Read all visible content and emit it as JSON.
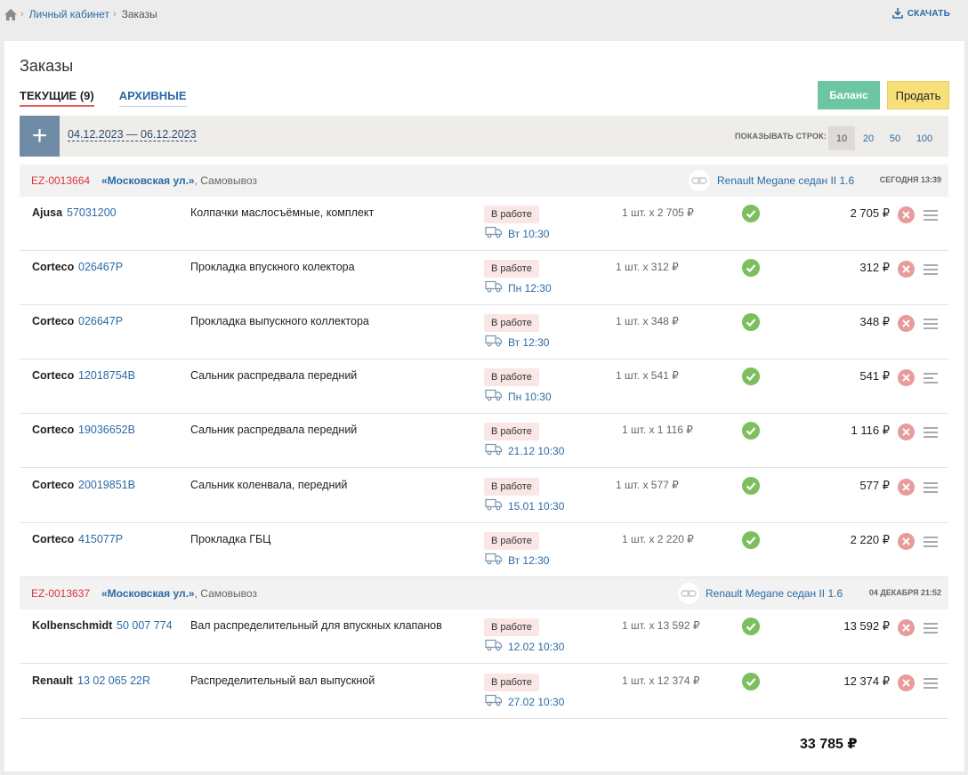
{
  "breadcrumb": {
    "home_icon": "home-icon",
    "cabinet": "Личный кабинет",
    "current": "Заказы"
  },
  "download": {
    "label": "СКАЧАТЬ",
    "icon": "download-icon"
  },
  "page": {
    "title": "Заказы"
  },
  "tabs": [
    {
      "label": "ТЕКУЩИЕ (9)",
      "active": true
    },
    {
      "label": "АРХИВНЫЕ",
      "active": false
    }
  ],
  "actions": {
    "balance": "Баланс",
    "sell": "Продать"
  },
  "filter": {
    "add_label": "+",
    "date_range": "04.12.2023 — 06.12.2023",
    "rows_label": "ПОКАЗЫВАТЬ СТРОК:",
    "rows_options": [
      "10",
      "20",
      "50",
      "100"
    ],
    "rows_selected": "10"
  },
  "orders": [
    {
      "id": "EZ-0013664",
      "address": "«Московская ул.»",
      "delivery": ", Самовывоз",
      "car": "Renault Megane седан II 1.6",
      "date": "СЕГОДНЯ 13:39",
      "items": [
        {
          "brand": "Ajusa",
          "number": "57031200",
          "name": "Колпачки маслосъёмные, комплект",
          "status": "В работе",
          "eta": "Вт 10:30",
          "qty": "1 шт. x 2 705 ₽",
          "price": "2 705 ₽"
        },
        {
          "brand": "Corteco",
          "number": "026467P",
          "name": "Прокладка впускного колектора",
          "status": "В работе",
          "eta": "Пн 12:30",
          "qty": "1 шт. x 312 ₽",
          "price": "312 ₽"
        },
        {
          "brand": "Corteco",
          "number": "026647P",
          "name": "Прокладка выпускного коллектора",
          "status": "В работе",
          "eta": "Вт 12:30",
          "qty": "1 шт. x 348 ₽",
          "price": "348 ₽"
        },
        {
          "brand": "Corteco",
          "number": "12018754B",
          "name": "Сальник распредвала передний",
          "status": "В работе",
          "eta": "Пн 10:30",
          "qty": "1 шт. x 541 ₽",
          "price": "541 ₽"
        },
        {
          "brand": "Corteco",
          "number": "19036652B",
          "name": "Сальник распредвала передний",
          "status": "В работе",
          "eta": "21.12 10:30",
          "qty": "1 шт. x 1 116 ₽",
          "price": "1 116 ₽"
        },
        {
          "brand": "Corteco",
          "number": "20019851B",
          "name": "Сальник коленвала, передний",
          "status": "В работе",
          "eta": "15.01 10:30",
          "qty": "1 шт. x 577 ₽",
          "price": "577 ₽"
        },
        {
          "brand": "Corteco",
          "number": "415077P",
          "name": "Прокладка ГБЦ",
          "status": "В работе",
          "eta": "Вт 12:30",
          "qty": "1 шт. x 2 220 ₽",
          "price": "2 220 ₽"
        }
      ]
    },
    {
      "id": "EZ-0013637",
      "address": "«Московская ул.»",
      "delivery": ", Самовывоз",
      "car": "Renault Megane седан II 1.6",
      "date": "04 ДЕКАБРЯ 21:52",
      "items": [
        {
          "brand": "Kolbenschmidt",
          "number": "50 007 774",
          "name": "Вал распределительный для впускных клапанов",
          "status": "В работе",
          "eta": "12.02 10:30",
          "qty": "1 шт. x 13 592 ₽",
          "price": "13 592 ₽"
        },
        {
          "brand": "Renault",
          "number": "13 02 065 22R",
          "name": "Распределительный вал выпускной",
          "status": "В работе",
          "eta": "27.02 10:30",
          "qty": "1 шт. x 12 374 ₽",
          "price": "12 374 ₽"
        }
      ]
    }
  ],
  "total": "33 785 ₽",
  "colors": {
    "accent_blue": "#2b6aa6",
    "order_id_red": "#d9353c",
    "balance_green": "#6cc6a3",
    "sell_yellow": "#f7e07a",
    "ok_green": "#7dbf5f",
    "cancel_red": "#e89b9b"
  }
}
